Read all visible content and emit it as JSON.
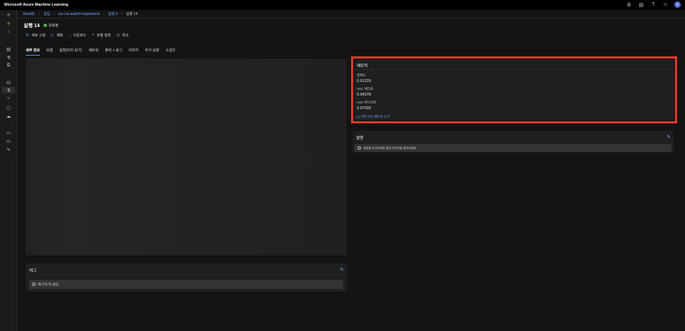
{
  "app": {
    "title": "Microsoft Azure Machine Learning",
    "avatar_initial": "A"
  },
  "breadcrumb": [
    "AutoML",
    "실험",
    "my-1st-automl-experiment",
    "실행 3",
    "실행 14"
  ],
  "run": {
    "title": "실행 14",
    "status": "완료됨"
  },
  "toolbar": {
    "refresh": "새로 고침",
    "deploy": "배포",
    "download": "다운로드",
    "explain": "모델 설명",
    "cancel": "취소"
  },
  "tabs": [
    "세부 정보",
    "모델",
    "설명(미리 보기)",
    "메트릭",
    "출력 + 로그",
    "이미지",
    "자식 실행",
    "스냅샷"
  ],
  "tags": {
    "title": "태그",
    "empty": "태그이(가) 없음"
  },
  "metrics": {
    "title": "메트릭",
    "items": [
      {
        "label": "정확도",
        "value": "0.91229"
      },
      {
        "label": "AUC 매크로",
        "value": "0.94378"
      },
      {
        "label": "AUC 마이크로",
        "value": "0.97926"
      }
    ],
    "more_link": "다른 모든 메트릭 보기"
  },
  "description": {
    "title": "설명",
    "hint": "설명을 추가하려면 편집 아이콘을 클릭하세요."
  },
  "colors": {
    "accent": "#6fa8ff",
    "highlight": "#e0392b",
    "success": "#3fa535"
  }
}
